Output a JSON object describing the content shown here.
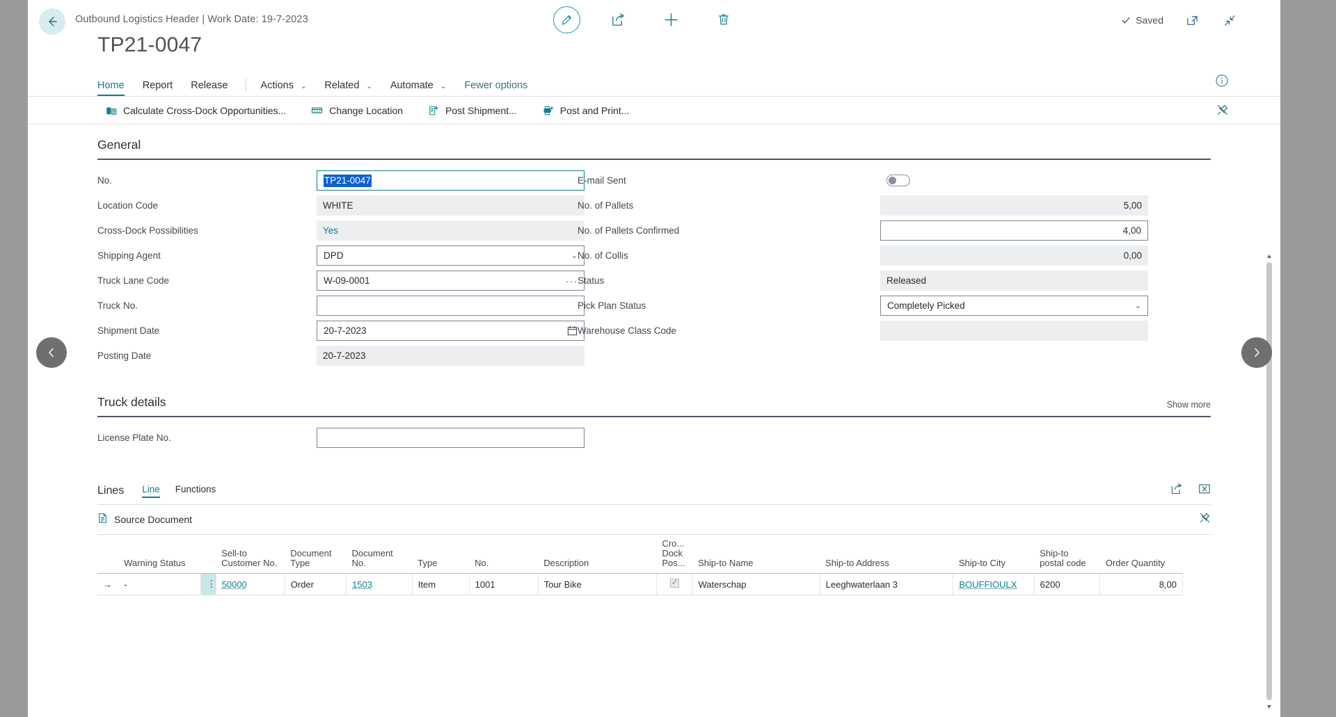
{
  "window": {
    "caption": "Outbound Logistics Header | Work Date: 19-7-2023",
    "title": "TP21-0047",
    "saved_label": "Saved",
    "back_icon": "back-arrow-icon",
    "edit_icon": "pencil-edit-icon",
    "share_icon": "share-icon",
    "new_icon": "plus-new-icon",
    "delete_icon": "trash-delete-icon",
    "open_new_window_icon": "open-in-new-window-icon",
    "collapse_icon": "collapse-arrows-icon",
    "accent": "#11808c",
    "selection_blue": "#0c5fd4"
  },
  "ribbon": {
    "tabs": [
      {
        "label": "Home",
        "active": true,
        "caret": false
      },
      {
        "label": "Report",
        "active": false,
        "caret": false
      },
      {
        "label": "Release",
        "active": false,
        "caret": false
      },
      {
        "label": "Actions",
        "active": false,
        "caret": true
      },
      {
        "label": "Related",
        "active": false,
        "caret": true
      },
      {
        "label": "Automate",
        "active": false,
        "caret": true
      },
      {
        "label": "Fewer options",
        "active": false,
        "caret": false
      }
    ],
    "info_icon": "info-circle-icon",
    "pin_icon": "unpin-icon"
  },
  "actions": [
    {
      "label": "Calculate Cross-Dock Opportunities...",
      "icon": "calculate-cross-dock-icon"
    },
    {
      "label": "Change Location",
      "icon": "change-location-icon"
    },
    {
      "label": "Post Shipment...",
      "icon": "post-shipment-icon"
    },
    {
      "label": "Post and Print...",
      "icon": "post-and-print-icon"
    }
  ],
  "general": {
    "title": "General",
    "left": [
      {
        "label": "No.",
        "value": "TP21-0047",
        "style": "focused",
        "selected": true
      },
      {
        "label": "Location Code",
        "value": "WHITE",
        "style": "readonly"
      },
      {
        "label": "Cross-Dock Possibilities",
        "value": "Yes",
        "style": "readonly",
        "link": true
      },
      {
        "label": "Shipping Agent",
        "value": "DPD",
        "style": "editable",
        "control": "dropdown"
      },
      {
        "label": "Truck Lane Code",
        "value": "W-09-0001",
        "style": "editable",
        "control": "lookup"
      },
      {
        "label": "Truck No.",
        "value": "",
        "style": "editable"
      },
      {
        "label": "Shipment Date",
        "value": "20-7-2023",
        "style": "editable",
        "control": "date"
      },
      {
        "label": "Posting Date",
        "value": "20-7-2023",
        "style": "readonly"
      }
    ],
    "right": [
      {
        "label": "E-mail Sent",
        "value": "",
        "style": "plain",
        "control": "toggle",
        "toggle_on": false
      },
      {
        "label": "No. of Pallets",
        "value": "5,00",
        "style": "readonly",
        "align": "num"
      },
      {
        "label": "No. of Pallets Confirmed",
        "value": "4,00",
        "style": "editable",
        "align": "num"
      },
      {
        "label": "No. of Collis",
        "value": "0,00",
        "style": "readonly",
        "align": "num"
      },
      {
        "label": "Status",
        "value": "Released",
        "style": "readonly"
      },
      {
        "label": "Pick Plan Status",
        "value": "Completely Picked",
        "style": "editable",
        "control": "dropdown"
      },
      {
        "label": "Warehouse Class Code",
        "value": "",
        "style": "readonly"
      }
    ]
  },
  "truck_details": {
    "title": "Truck details",
    "show_more": "Show more",
    "fields": [
      {
        "label": "License Plate No.",
        "value": "",
        "style": "editable"
      }
    ]
  },
  "lines": {
    "title": "Lines",
    "subtabs": [
      {
        "label": "Line",
        "active": true
      },
      {
        "label": "Functions",
        "active": false
      }
    ],
    "share_icon": "share-icon",
    "open_excel_icon": "open-in-excel-icon",
    "source_document": {
      "label": "Source Document",
      "icon": "document-icon"
    },
    "pin_icon": "unpin-icon",
    "columns": [
      {
        "label": "",
        "key": "arrow",
        "align": "left"
      },
      {
        "label": "Warning Status",
        "key": "warning_status",
        "align": "left"
      },
      {
        "label": "",
        "key": "drag",
        "align": "left"
      },
      {
        "label": "Sell-to\nCustomer No.",
        "key": "sell_to_customer_no",
        "align": "left"
      },
      {
        "label": "Document\nType",
        "key": "document_type",
        "align": "left"
      },
      {
        "label": "Document No.",
        "key": "document_no",
        "align": "left"
      },
      {
        "label": "Type",
        "key": "type",
        "align": "left"
      },
      {
        "label": "No.",
        "key": "no",
        "align": "left"
      },
      {
        "label": "Description",
        "key": "description",
        "align": "left"
      },
      {
        "label": "Cro...\nDock\nPos...",
        "key": "cross_dock",
        "align": "left"
      },
      {
        "label": "Ship-to Name",
        "key": "ship_to_name",
        "align": "left"
      },
      {
        "label": "Ship-to Address",
        "key": "ship_to_address",
        "align": "left"
      },
      {
        "label": "Ship-to City",
        "key": "ship_to_city",
        "align": "left"
      },
      {
        "label": "Ship-to\npostal code",
        "key": "ship_to_postal_code",
        "align": "left"
      },
      {
        "label": "Order Quantity",
        "key": "order_quantity",
        "align": "num"
      }
    ],
    "rows": [
      {
        "warning_status": "-",
        "sell_to_customer_no": "50000",
        "document_type": "Order",
        "document_no": "1503",
        "type": "Item",
        "no": "1001",
        "description": "Tour Bike",
        "cross_dock_checked": true,
        "ship_to_name": "Waterschap",
        "ship_to_address": "Leeghwaterlaan 3",
        "ship_to_city": "BOUFFIOULX",
        "ship_to_postal_code": "6200",
        "order_quantity": "8,00"
      }
    ]
  },
  "pager": {
    "prev_icon": "chevron-left-icon",
    "next_icon": "chevron-right-icon"
  }
}
